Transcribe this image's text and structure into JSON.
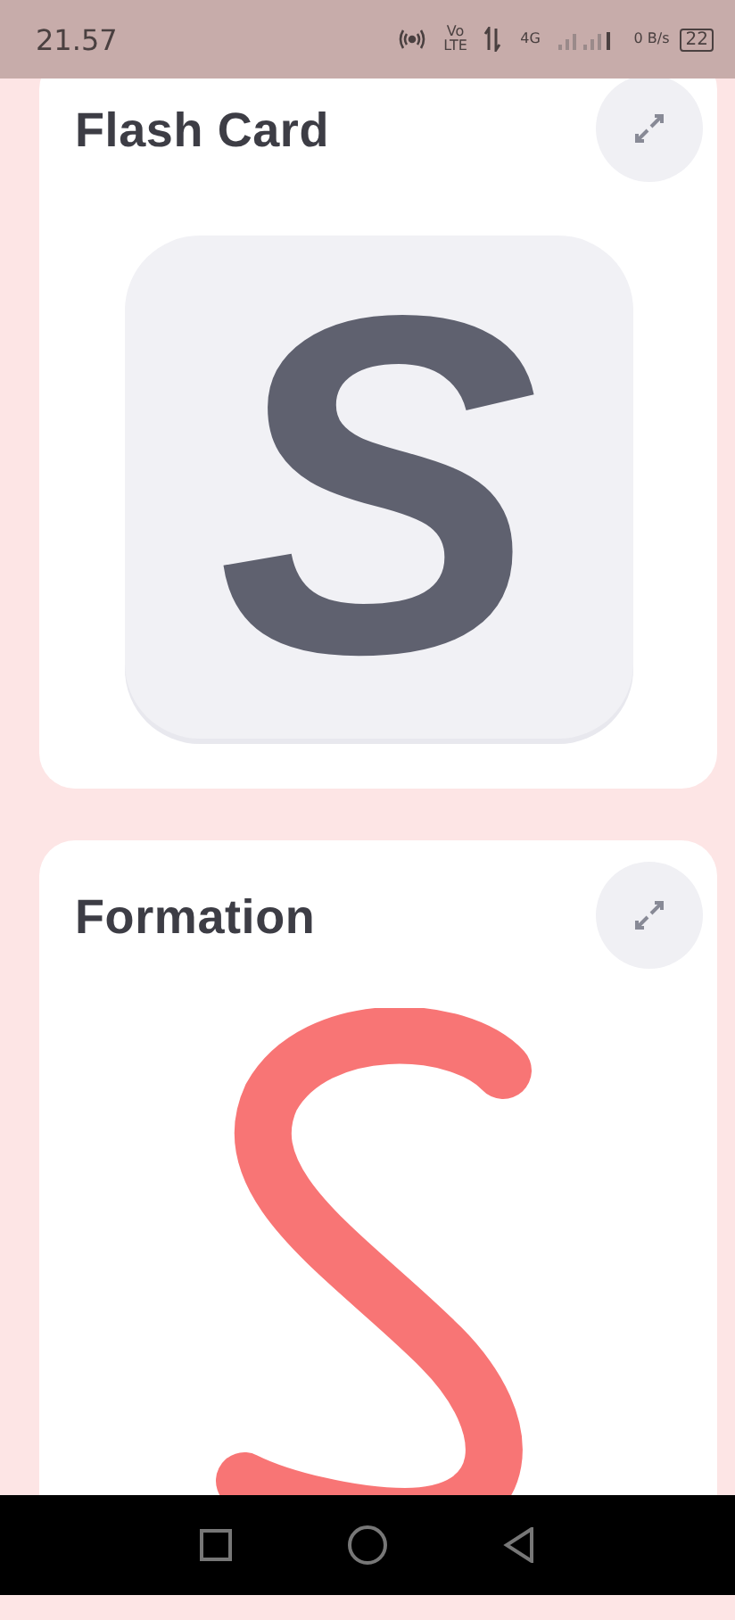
{
  "status_bar": {
    "time": "21.57",
    "volte": "Vo LTE",
    "network": "4G",
    "speed": "0 B/s",
    "battery": "22"
  },
  "cards": [
    {
      "kind": "flash",
      "title": "Flash Card",
      "letter": "S"
    },
    {
      "kind": "formation",
      "title": "Formation"
    }
  ]
}
